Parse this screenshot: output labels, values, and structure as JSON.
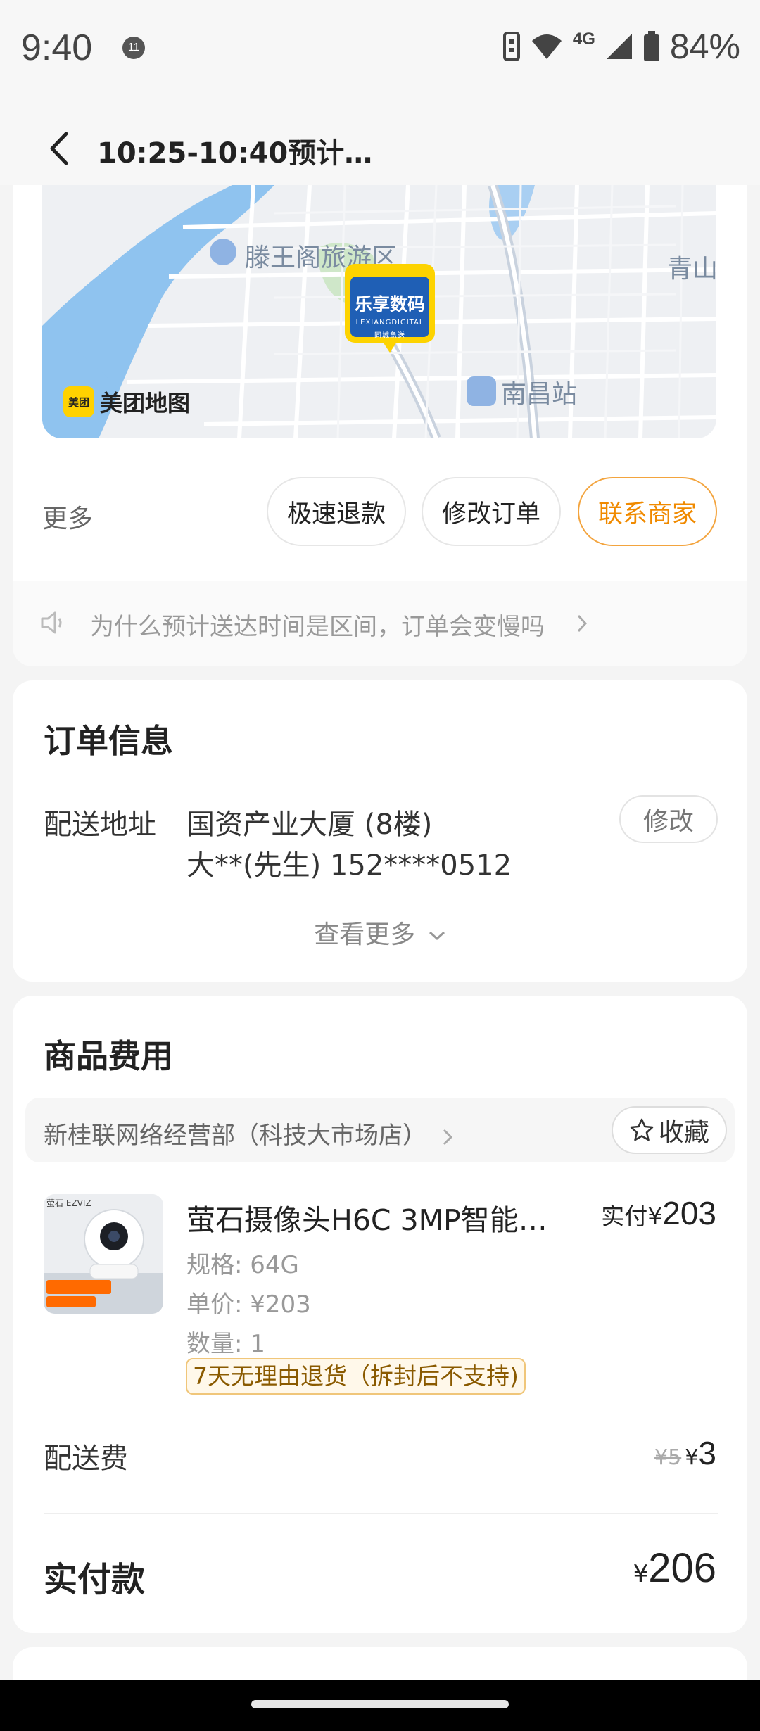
{
  "status_bar": {
    "time": "9:40",
    "notification_count": "11",
    "network_type": "4G",
    "battery_percent": "84%"
  },
  "header": {
    "title": "10:25-10:40预计…"
  },
  "map": {
    "labels": {
      "tengwang": "滕王阁旅游区",
      "station": "南昌站",
      "qing": "青山"
    },
    "brand": {
      "badge": "美团",
      "name": "美团地图"
    },
    "store_pin": {
      "name": "乐享数码",
      "sub": "LEXIANGDIGITAL",
      "tag": "同城急送"
    }
  },
  "actions": {
    "more_label": "更多",
    "buttons": [
      {
        "label": "极速退款"
      },
      {
        "label": "修改订单"
      },
      {
        "label": "联系商家"
      }
    ]
  },
  "notice": {
    "text": "为什么预计送达时间是区间，订单会变慢吗"
  },
  "order_info": {
    "title": "订单信息",
    "address_label": "配送地址",
    "address_line1": "国资产业大厦 (8楼)",
    "address_line2": "大**(先生) 152****0512",
    "modify_label": "修改",
    "view_more_label": "查看更多"
  },
  "goods": {
    "title": "商品费用",
    "store_name": "新桂联网络经营部（科技大市场店）",
    "favorite_label": "收藏",
    "product": {
      "image_brand": "萤石 EZVIZ",
      "name": "萤石摄像头H6C 3MP智能…",
      "paid_label": "实付",
      "paid_currency": "¥",
      "paid_amount": "203",
      "spec": "规格: 64G",
      "unit_price": "单价: ¥203",
      "quantity": "数量: 1",
      "return_policy": "7天无理由退货（拆封后不支持)"
    },
    "delivery_fee_label": "配送费",
    "delivery_fee_old": "¥5",
    "delivery_fee_currency": "¥",
    "delivery_fee_new": "3",
    "total_label": "实付款",
    "total_currency": "¥",
    "total_amount": "206"
  },
  "colors": {
    "accent": "#f08a00",
    "map_water": "#8fc3ef",
    "pin_yellow": "#fdd300",
    "pin_blue": "#1f5fb5"
  }
}
